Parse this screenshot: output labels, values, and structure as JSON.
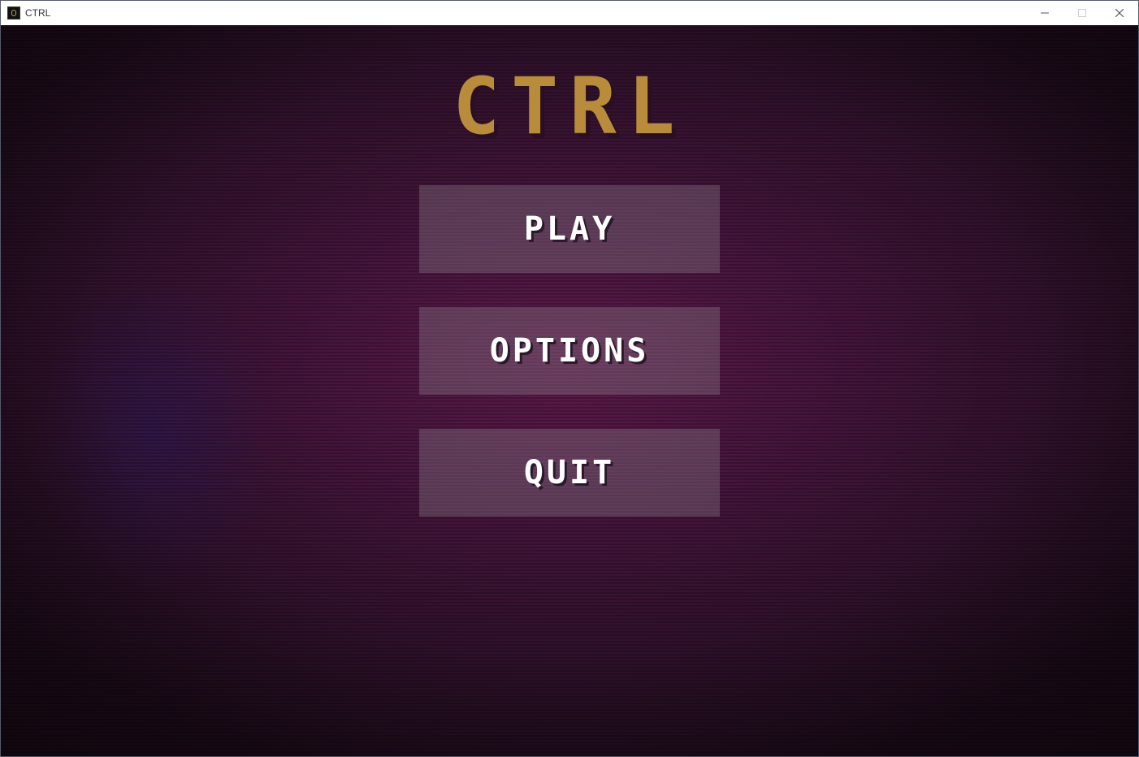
{
  "window": {
    "title": "CTRL",
    "app_icon": "ctrl-app-icon",
    "controls": [
      "minimize-icon",
      "maximize-icon",
      "close-icon"
    ]
  },
  "game": {
    "title": "CTRL",
    "title_color": "#b88c3a",
    "menu": {
      "play_label": "PLAY",
      "options_label": "OPTIONS",
      "quit_label": "QUIT"
    }
  }
}
